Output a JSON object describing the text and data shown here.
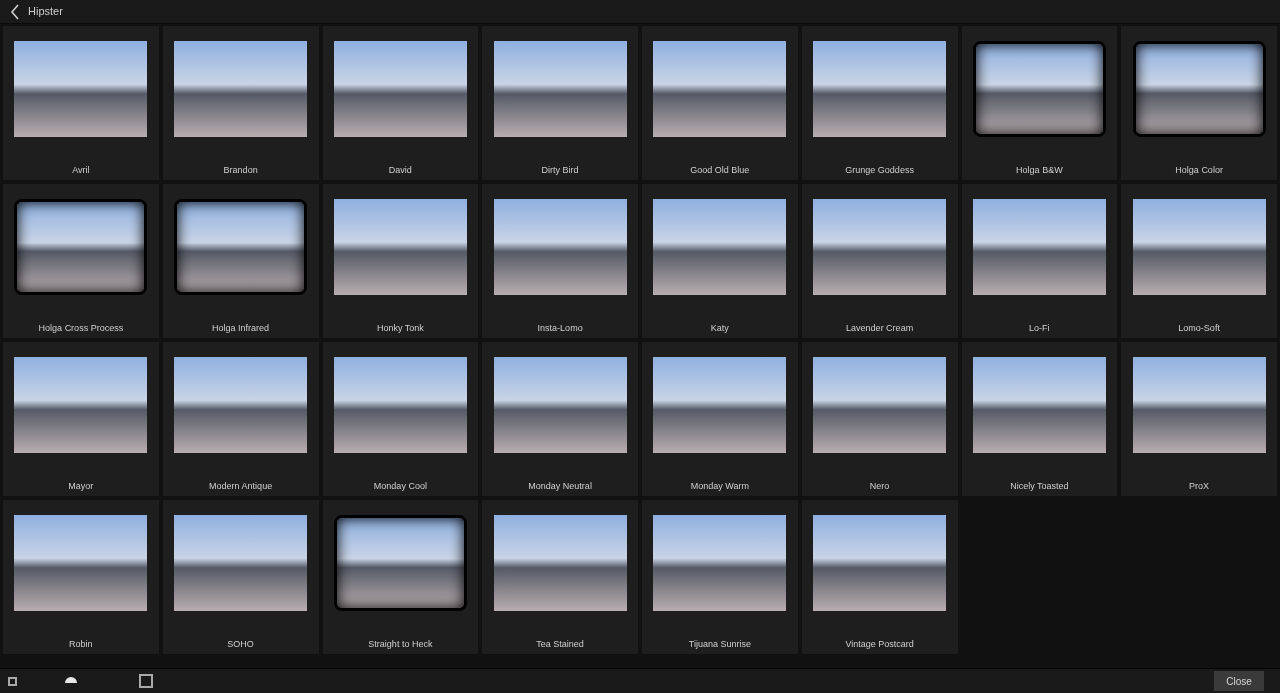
{
  "header": {
    "title": "Hipster"
  },
  "presets": [
    {
      "label": "Avril",
      "framed": false
    },
    {
      "label": "Brandon",
      "framed": false
    },
    {
      "label": "David",
      "framed": false
    },
    {
      "label": "Dirty Bird",
      "framed": false
    },
    {
      "label": "Good Old Blue",
      "framed": false
    },
    {
      "label": "Grunge Goddess",
      "framed": false
    },
    {
      "label": "Holga B&W",
      "framed": true
    },
    {
      "label": "Holga Color",
      "framed": true
    },
    {
      "label": "Holga Cross Process",
      "framed": true
    },
    {
      "label": "Holga Infrared",
      "framed": true
    },
    {
      "label": "Honky Tonk",
      "framed": false
    },
    {
      "label": "Insta-Lomo",
      "framed": false
    },
    {
      "label": "Katy",
      "framed": false
    },
    {
      "label": "Lavender Cream",
      "framed": false
    },
    {
      "label": "Lo-Fi",
      "framed": false
    },
    {
      "label": "Lomo-Soft",
      "framed": false
    },
    {
      "label": "Mayor",
      "framed": false
    },
    {
      "label": "Modern Antique",
      "framed": false
    },
    {
      "label": "Monday Cool",
      "framed": false
    },
    {
      "label": "Monday Neutral",
      "framed": false
    },
    {
      "label": "Monday Warm",
      "framed": false
    },
    {
      "label": "Nero",
      "framed": false
    },
    {
      "label": "Nicely Toasted",
      "framed": false
    },
    {
      "label": "ProX",
      "framed": false
    },
    {
      "label": "Robin",
      "framed": false
    },
    {
      "label": "SOHO",
      "framed": false
    },
    {
      "label": "Straight to Heck",
      "framed": true
    },
    {
      "label": "Tea Stained",
      "framed": false
    },
    {
      "label": "Tijuana Sunrise",
      "framed": false
    },
    {
      "label": "Vintage Postcard",
      "framed": false
    }
  ],
  "size_slider": {
    "level": 0.44
  },
  "close_button": "Close"
}
